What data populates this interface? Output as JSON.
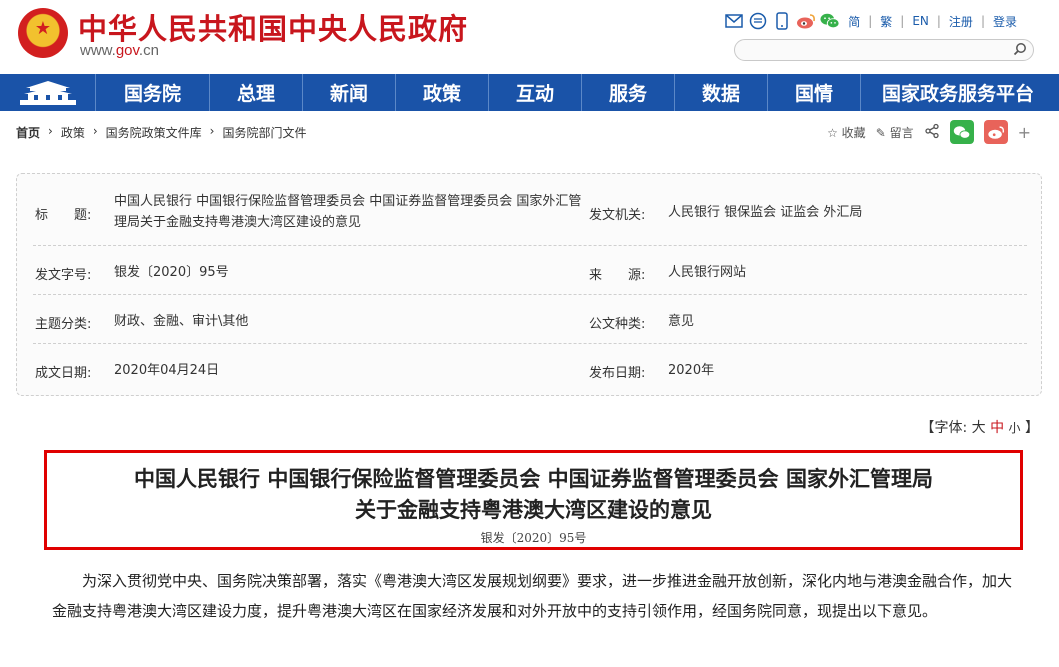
{
  "header": {
    "site_title": "中华人民共和国中央人民政府",
    "url_prefix": "www.",
    "url_mid": "gov",
    "url_suffix": ".cn",
    "tools": [
      "简",
      "繁",
      "EN",
      "注册",
      "登录"
    ],
    "search_placeholder": ""
  },
  "nav": {
    "items": [
      "国务院",
      "总理",
      "新闻",
      "政策",
      "互动",
      "服务",
      "数据",
      "国情",
      "国家政务服务平台"
    ]
  },
  "breadcrumb": [
    "首页",
    "政策",
    "国务院政策文件库",
    "国务院部门文件"
  ],
  "crumb_tools": {
    "favorite": "收藏",
    "comment": "留言",
    "plus": "+"
  },
  "info": {
    "title_label": "标　　题:",
    "title_value": "中国人民银行 中国银行保险监督管理委员会 中国证券监督管理委员会 国家外汇管理局关于金融支持粤港澳大湾区建设的意见",
    "issuer_label": "发文机关:",
    "issuer_value": "人民银行 银保监会 证监会 外汇局",
    "docno_label": "发文字号:",
    "docno_value": "银发〔2020〕95号",
    "source_label": "来　　源:",
    "source_value": "人民银行网站",
    "category_label": "主题分类:",
    "category_value": "财政、金融、审计\\其他",
    "doctype_label": "公文种类:",
    "doctype_value": "意见",
    "date_label": "成文日期:",
    "date_value": "2020年04月24日",
    "publish_label": "发布日期:",
    "publish_value": "2020年"
  },
  "fontsize": {
    "prefix": "【字体:",
    "large": "大",
    "medium": "中",
    "small": "小",
    "suffix": "】"
  },
  "document": {
    "title_line1": "中国人民银行 中国银行保险监督管理委员会 中国证券监督管理委员会 国家外汇管理局",
    "title_line2": "关于金融支持粤港澳大湾区建设的意见",
    "doc_number": "银发〔2020〕95号",
    "paragraph1": "为深入贯彻党中央、国务院决策部署，落实《粤港澳大湾区发展规划纲要》要求，进一步推进金融开放创新，深化内地与港澳金融合作，加大金融支持粤港澳大湾区建设力度，提升粤港澳大湾区在国家经济发展和对外开放中的支持引领作用，经国务院同意，现提出以下意见。"
  },
  "colors": {
    "brand_red": "#c8161d",
    "nav_blue": "#1a53a8",
    "wechat_green": "#36b14a",
    "weibo_red": "#e8635a",
    "highlight_border": "#e00000"
  }
}
